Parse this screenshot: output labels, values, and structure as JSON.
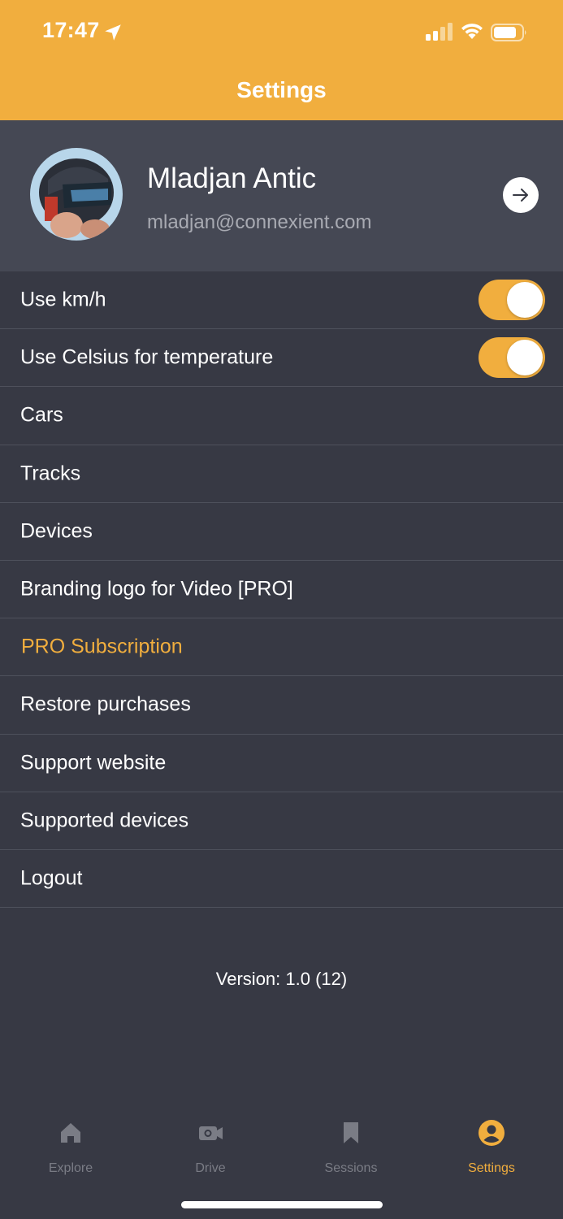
{
  "status_bar": {
    "time": "17:47"
  },
  "header": {
    "title": "Settings"
  },
  "profile": {
    "name": "Mladjan Antic",
    "email": "mladjan@connexient.com"
  },
  "settings": {
    "use_kmh": {
      "label": "Use km/h",
      "on": true
    },
    "use_celsius": {
      "label": "Use Celsius for temperature",
      "on": true
    },
    "items": [
      {
        "label": "Cars"
      },
      {
        "label": "Tracks"
      },
      {
        "label": "Devices"
      },
      {
        "label": "Branding logo for Video [PRO]"
      },
      {
        "label": "PRO Subscription"
      },
      {
        "label": "Restore purchases"
      },
      {
        "label": "Support website"
      },
      {
        "label": "Supported devices"
      },
      {
        "label": "Logout"
      }
    ]
  },
  "version": "Version: 1.0 (12)",
  "tabbar": {
    "tabs": [
      {
        "label": "Explore",
        "icon": "home-icon"
      },
      {
        "label": "Drive",
        "icon": "camera-icon"
      },
      {
        "label": "Sessions",
        "icon": "bookmark-icon"
      },
      {
        "label": "Settings",
        "icon": "user-circle-icon",
        "active": true
      }
    ]
  },
  "colors": {
    "accent": "#F1AE3E",
    "background": "#373944",
    "profile_bg": "#454854"
  }
}
